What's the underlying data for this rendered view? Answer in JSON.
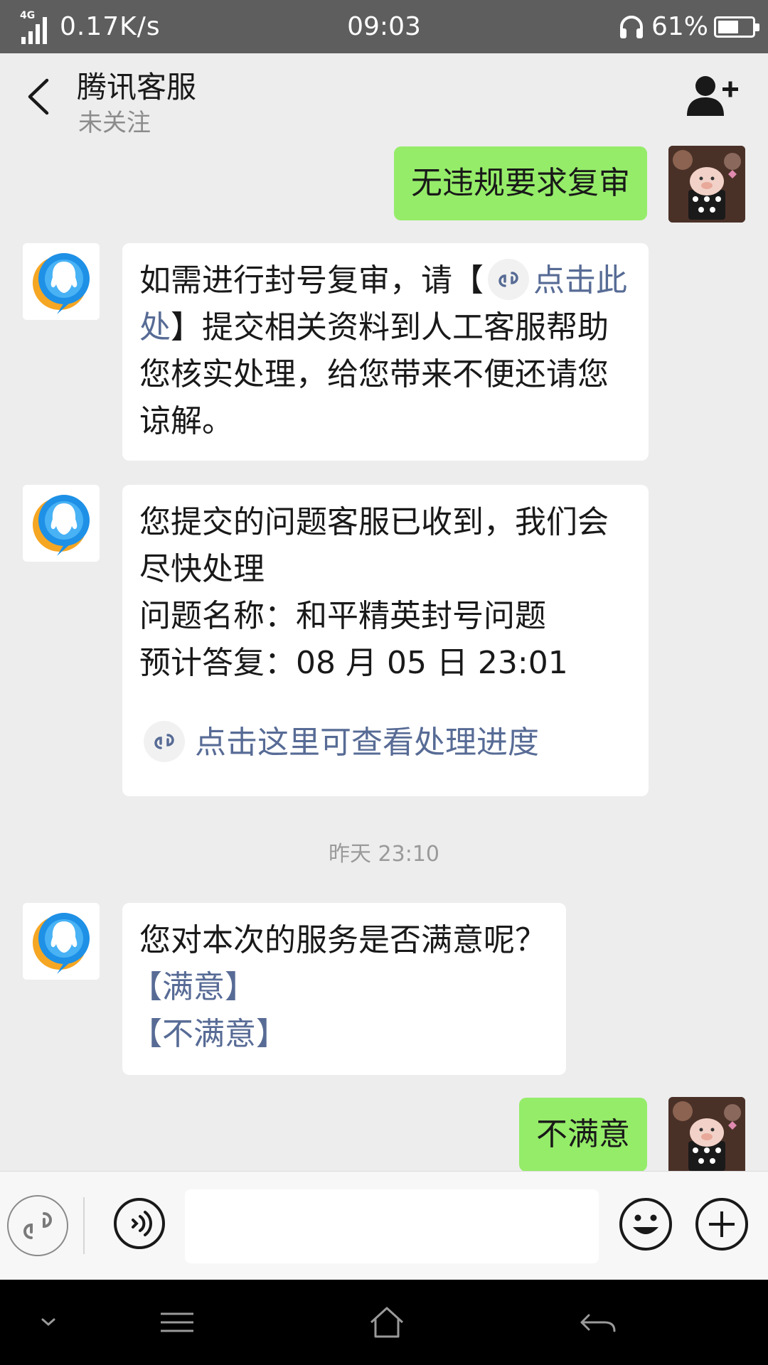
{
  "status_bar": {
    "network": "4G",
    "speed": "0.17K/s",
    "time": "09:03",
    "battery": "61%",
    "battery_level": 0.61
  },
  "header": {
    "title": "腾讯客服",
    "subtitle": "未关注",
    "back_icon": "chevron-left-icon",
    "add_user_icon": "add-user-icon"
  },
  "messages": {
    "m1": {
      "text": "无违规要求复审"
    },
    "m2": {
      "text_before": "如需进行封号复审，请【",
      "link": "点击此处",
      "text_after": "】提交相关资料到人工客服帮助您核实处理，给您带来不便还请您谅解。"
    },
    "m3": {
      "line1": "您提交的问题客服已收到，我们会尽快处理",
      "line2": "问题名称：和平精英封号问题",
      "line3": "预计答复：08 月 05 日 23:01",
      "link": "点击这里可查看处理进度"
    },
    "timestamp": "昨天 23:10",
    "m4": {
      "question": "您对本次的服务是否满意呢？",
      "option1": "【满意】",
      "option2": "【不满意】"
    },
    "m5": {
      "text": "不满意"
    }
  },
  "input_bar": {
    "mini_program_icon": "link-icon",
    "voice_icon": "voice-icon",
    "emoji_icon": "emoji-icon",
    "plus_icon": "plus-icon"
  },
  "colors": {
    "outgoing_bubble": "#95ec69",
    "link": "#576b95",
    "background": "#ededed"
  }
}
